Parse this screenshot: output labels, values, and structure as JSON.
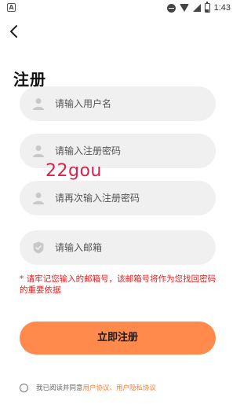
{
  "status_bar": {
    "notification_badge": "A",
    "time": "1:43",
    "icons": [
      "dnd-icon",
      "wifi-icon",
      "signal-icon",
      "battery-icon"
    ]
  },
  "header": {
    "back_icon": "chevron-left-icon"
  },
  "page": {
    "title": "注册"
  },
  "form": {
    "username_placeholder": "请输入用户名",
    "password_placeholder": "请输入注册密码",
    "password_confirm_placeholder": "请再次输入注册密码",
    "email_placeholder": "请输入邮箱"
  },
  "watermark": "22gou",
  "notice": "* 请牢记您输入的邮箱号，该邮箱号将作为您找回密码的重要依据",
  "register_button_label": "立即注册",
  "agreement": {
    "prefix": "我已阅读并同意 ",
    "user_agreement": "用户协议",
    "separator": "、",
    "privacy_agreement": "用户隐私协议"
  },
  "colors": {
    "accent": "#ff8a4c",
    "link": "#ff7a30",
    "notice": "#e02020",
    "field_bg": "#f0f0f0"
  }
}
